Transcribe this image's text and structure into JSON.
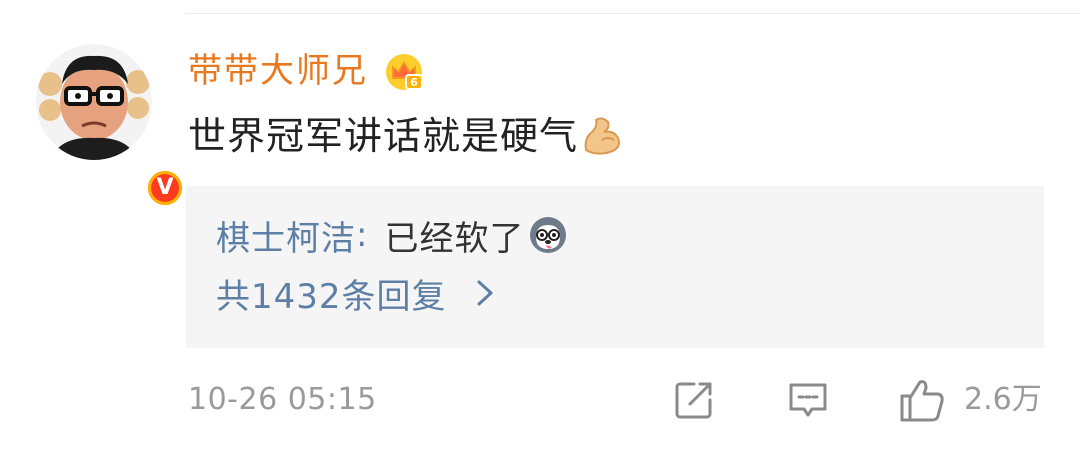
{
  "comment": {
    "username": "带带大师兄",
    "username_color": "#e8791f",
    "text": "世界冠军讲话就是硬气",
    "emoji": "muscle-icon"
  },
  "avatar": {
    "badge": "V"
  },
  "reply_preview": {
    "author": "棋士柯洁",
    "colon": ":",
    "content": "已经软了",
    "emoji": "husky-icon",
    "more_label": "共1432条回复"
  },
  "footer": {
    "timestamp": "10-26 05:15",
    "like_count": "2.6万"
  },
  "colors": {
    "link_blue": "#5d7fa6",
    "meta_gray": "#9a9a9a",
    "reply_bg": "#f5f5f5"
  }
}
